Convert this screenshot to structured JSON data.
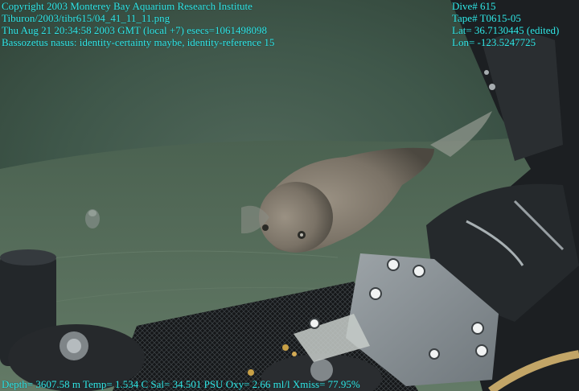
{
  "overlay": {
    "top_left": [
      "Copyright 2003 Monterey Bay Aquarium Research Institute",
      "Tiburon/2003/tibr615/04_41_11_11.png",
      "Thu Aug 21 20:34:58 2003 GMT (local +7)  esecs=1061498098",
      "Bassozetus nasus: identity-certainty maybe, identity-reference 15"
    ],
    "top_right": [
      "Dive# 615",
      "Tape# T0615-05",
      "Lat= 36.7130445 (edited)",
      "Lon= -123.5247725"
    ],
    "bottom": "Depth= 3607.58 m  Temp= 1.534 C  Sal= 34.501 PSU  Oxy= 2.66 ml/l  Xmiss= 77.95%"
  },
  "colors": {
    "overlay_text": "#34e6e6",
    "water": "#4f6858",
    "seafloor": "#5e7563",
    "fish": "#7d766a",
    "equipment_dark": "#1c1f22",
    "panel_metal": "#8e959a"
  }
}
